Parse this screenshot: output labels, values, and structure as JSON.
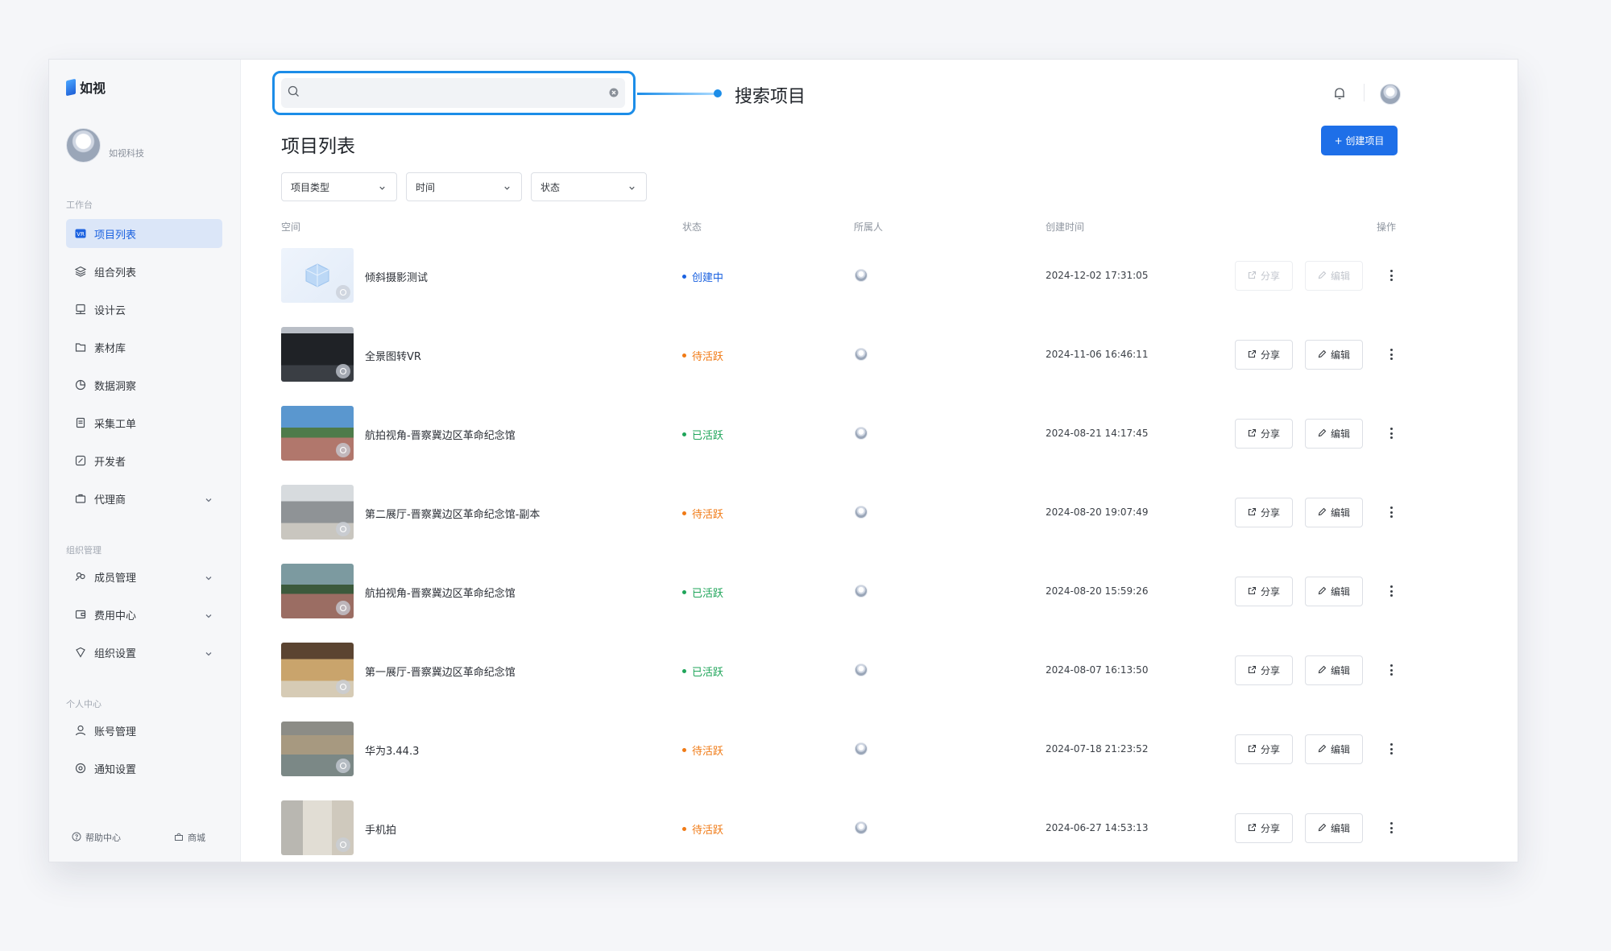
{
  "app": {
    "brand": "如视"
  },
  "profile": {
    "org_name": "如视科技"
  },
  "sidebar": {
    "groups": [
      "工作台",
      "组织管理",
      "个人中心"
    ],
    "items": [
      {
        "label": "项目列表",
        "icon": "project-list-icon",
        "active": true
      },
      {
        "label": "组合列表",
        "icon": "layers-icon"
      },
      {
        "label": "设计云",
        "icon": "monitor-icon"
      },
      {
        "label": "素材库",
        "icon": "folder-icon"
      },
      {
        "label": "数据洞察",
        "icon": "pie-chart-icon"
      },
      {
        "label": "采集工单",
        "icon": "document-icon"
      },
      {
        "label": "开发者",
        "icon": "code-icon"
      },
      {
        "label": "代理商",
        "icon": "briefcase-icon",
        "expandable": true
      },
      {
        "label": "成员管理",
        "icon": "members-icon",
        "expandable": true
      },
      {
        "label": "费用中心",
        "icon": "wallet-icon",
        "expandable": true
      },
      {
        "label": "组织设置",
        "icon": "shield-icon",
        "expandable": true
      },
      {
        "label": "账号管理",
        "icon": "user-icon"
      },
      {
        "label": "通知设置",
        "icon": "settings-icon"
      }
    ],
    "footer": {
      "help": "帮助中心",
      "store": "商城"
    }
  },
  "search": {
    "placeholder": "",
    "callout": "搜索项目"
  },
  "header": {
    "title": "项目列表",
    "create_label": "+ 创建项目"
  },
  "filters": [
    "项目类型",
    "时间",
    "状态"
  ],
  "table": {
    "columns": [
      "空间",
      "状态",
      "所属人",
      "创建时间",
      "操作"
    ],
    "share_label": "分享",
    "edit_label": "编辑",
    "rows": [
      {
        "name": "倾斜摄影测试",
        "status": "创建中",
        "time": "2024-12-02 17:31:05",
        "disabled": true
      },
      {
        "name": "全景图转VR",
        "status": "待活跃",
        "time": "2024-11-06 16:46:11"
      },
      {
        "name": "航拍视角-晋察冀边区革命纪念馆",
        "status": "已活跃",
        "time": "2024-08-21 14:17:45"
      },
      {
        "name": "第二展厅-晋察冀边区革命纪念馆-副本",
        "status": "待活跃",
        "time": "2024-08-20 19:07:49"
      },
      {
        "name": "航拍视角-晋察冀边区革命纪念馆",
        "status": "已活跃",
        "time": "2024-08-20 15:59:26"
      },
      {
        "name": "第一展厅-晋察冀边区革命纪念馆",
        "status": "已活跃",
        "time": "2024-08-07 16:13:50"
      },
      {
        "name": "华为3.44.3",
        "status": "待活跃",
        "time": "2024-07-18 21:23:52"
      },
      {
        "name": "手机拍",
        "status": "待活跃",
        "time": "2024-06-27 14:53:13"
      }
    ]
  },
  "colors": {
    "accent": "#1e6fe8",
    "status_creating": "#1b62e0",
    "status_pending": "#f07a15",
    "status_active": "#1fa55a"
  }
}
